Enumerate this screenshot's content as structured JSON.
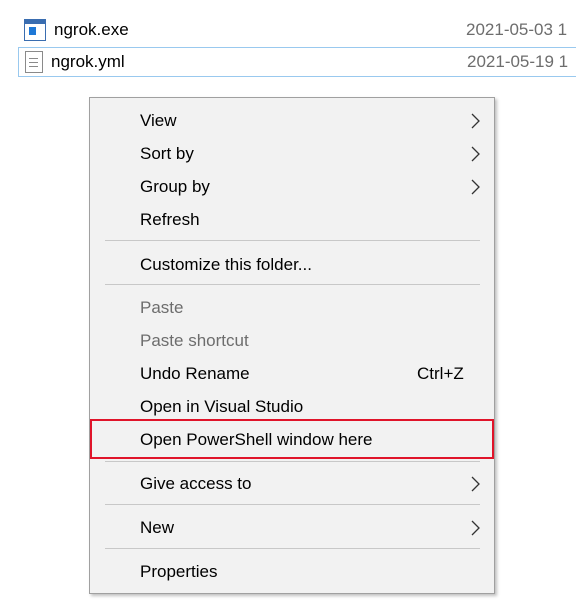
{
  "files": [
    {
      "name": "ngrok.exe",
      "date": "2021-05-03 1",
      "icon": "exe-file-icon"
    },
    {
      "name": "ngrok.yml",
      "date": "2021-05-19 1",
      "icon": "document-file-icon"
    }
  ],
  "menu": {
    "items": [
      {
        "label": "View",
        "submenu": true
      },
      {
        "label": "Sort by",
        "submenu": true
      },
      {
        "label": "Group by",
        "submenu": true
      },
      {
        "label": "Refresh"
      },
      {
        "label": "Customize this folder..."
      },
      {
        "label": "Paste",
        "disabled": true
      },
      {
        "label": "Paste shortcut",
        "disabled": true
      },
      {
        "label": "Undo Rename",
        "shortcut": "Ctrl+Z"
      },
      {
        "label": "Open in Visual Studio"
      },
      {
        "label": "Open PowerShell window here",
        "highlighted": true
      },
      {
        "label": "Give access to",
        "submenu": true
      },
      {
        "label": "New",
        "submenu": true
      },
      {
        "label": "Properties"
      }
    ]
  },
  "colors": {
    "menu_background": "#f2f2f2",
    "highlight_border": "#e0142a",
    "disabled_text": "#6d6d6d",
    "selected_row_border": "#99c9ef"
  }
}
